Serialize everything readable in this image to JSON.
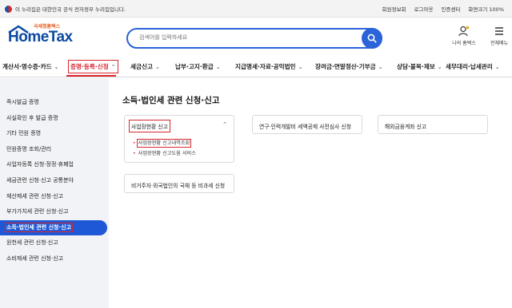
{
  "topbar": {
    "gov_notice": "이 누리집은 대한민국 공식 전자정부 누리집입니다.",
    "links": [
      "회원정보회",
      "로그아웃",
      "인증센터",
      "화면크기 100%"
    ]
  },
  "header": {
    "logo_sub": "국세청홈택스",
    "logo_main": "HomeTax",
    "search_placeholder": "검색어를 입력하세요",
    "my_hometax": "나의 홈택스",
    "all_menu": "전체메뉴"
  },
  "gnb": [
    {
      "label": "계산서·영수증·카드"
    },
    {
      "label": "증명·등록·신청"
    },
    {
      "label": "세금신고"
    },
    {
      "label": "납부·고지·환급"
    },
    {
      "label": "지급명세·자료·공익법인"
    },
    {
      "label": "장려금·연말정산·기부금"
    },
    {
      "label": "상담·불복·제보"
    },
    {
      "label": "세무대리·납세관리"
    }
  ],
  "sidebar": {
    "items": [
      {
        "label": "즉시발급 증명"
      },
      {
        "label": "사실확인 후 발급 증명"
      },
      {
        "label": "기타 민원 증명"
      },
      {
        "label": "민원증명 조회/관리"
      },
      {
        "label": "사업자등록 신청·정정·휴폐업"
      },
      {
        "label": "세금관련 신청·신고 공통분야"
      },
      {
        "label": "재산제세 관련 신청·신고"
      },
      {
        "label": "부가가치세 관련 신청·신고"
      },
      {
        "label": "소득·법인세 관련 신청·신고"
      },
      {
        "label": "원천세 관련 신청·신고"
      },
      {
        "label": "소비제세 관련 신청·신고"
      }
    ]
  },
  "main": {
    "title": "소득·법인세 관련 신청·신고",
    "card1": {
      "title": "사업장현황 신고",
      "items": [
        "사업장현황 신고내역조회",
        "사업장현황 신고도움 서비스"
      ]
    },
    "card2": {
      "title": "연구·인력개발비 세액공제 사전심사 신청"
    },
    "card3": {
      "title": "해외금융계좌 신고"
    },
    "card4": {
      "title": "비거주자·외국법인의 국채 등 비과세 신청"
    }
  }
}
